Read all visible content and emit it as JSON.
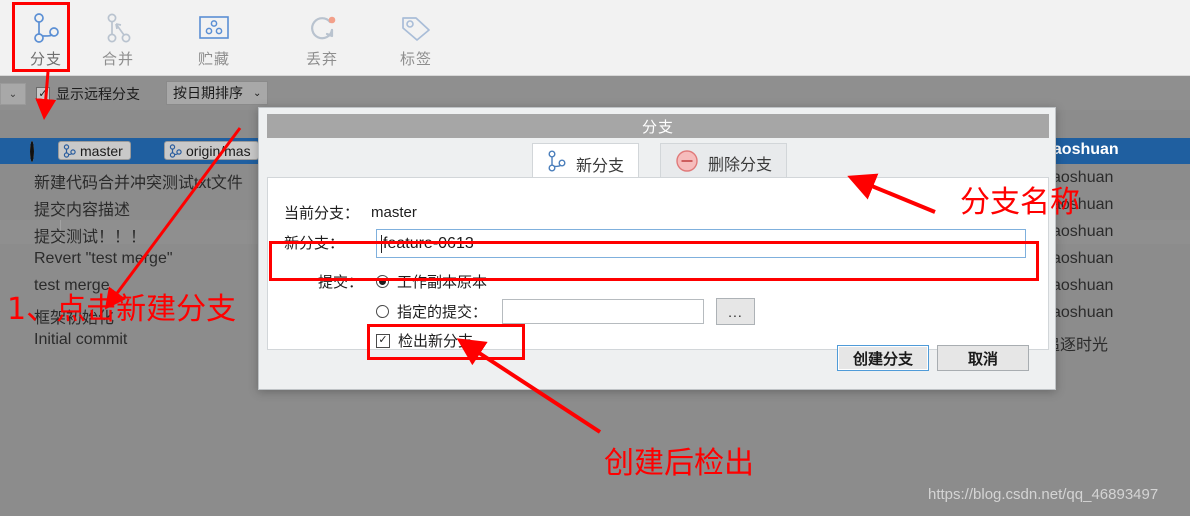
{
  "toolbar": {
    "items": [
      {
        "label": "分支",
        "icon": "branch-icon",
        "active": true
      },
      {
        "label": "合并",
        "icon": "merge-icon",
        "active": false
      },
      {
        "label": "贮藏",
        "icon": "stash-icon",
        "active": false
      },
      {
        "label": "丢弃",
        "icon": "discard-icon",
        "active": false
      },
      {
        "label": "标签",
        "icon": "tag-icon",
        "active": false
      }
    ]
  },
  "filter_bar": {
    "chevron": "⌄",
    "show_remote_label": "显示远程分支",
    "show_remote_checked": true,
    "sort_label": "按日期排序",
    "sort_chevron": "⌄"
  },
  "commit_list": {
    "rows": [
      {
        "message": "",
        "author": "yaoshuan",
        "selected": true,
        "refs": [
          {
            "label": "master",
            "icon": "branch-icon"
          },
          {
            "label": "origin/mas",
            "icon": "branch-icon"
          }
        ]
      },
      {
        "message": "新建代码合并冲突测试txt文件",
        "author": "yaoshuan",
        "selected": false,
        "refs": []
      },
      {
        "message": "提交内容描述",
        "author": "yaoshuan",
        "selected": false,
        "refs": []
      },
      {
        "message": "提交测试！！！",
        "author": "yaoshuan",
        "selected": false,
        "refs": []
      },
      {
        "message": "Revert \"test merge\"",
        "author": "yaoshuan",
        "selected": false,
        "refs": []
      },
      {
        "message": "test merge",
        "author": "yaoshuan",
        "selected": false,
        "refs": []
      },
      {
        "message": "框架初始化",
        "author": "yaoshuan",
        "selected": false,
        "refs": []
      },
      {
        "message": "Initial commit",
        "author": "追逐时光",
        "selected": false,
        "refs": []
      }
    ]
  },
  "dialog": {
    "title": "分支",
    "tabs": [
      {
        "label": "新分支",
        "icon": "branch-icon",
        "selected": true
      },
      {
        "label": "删除分支",
        "icon": "minus-circle-icon",
        "selected": false
      }
    ],
    "current_branch_label": "当前分支：",
    "current_branch_value": "master",
    "new_branch_label": "新分支：",
    "new_branch_value": "feature-0613",
    "commit_label": "提交：",
    "radio_working_copy": "工作副本原本",
    "radio_working_copy_selected": true,
    "radio_specified_commit": "指定的提交：",
    "radio_specified_selected": false,
    "specified_commit_value": "",
    "browse_button": "...",
    "checkout_label": "检出新分支",
    "checkout_checked": true,
    "create_button": "创建分支",
    "cancel_button": "取消"
  },
  "annotations": [
    {
      "id": "anno-click-new-branch",
      "text": "1、点击新建分支"
    },
    {
      "id": "anno-branch-name",
      "text": "分支名称"
    },
    {
      "id": "anno-checkout-after-create",
      "text": "创建后检出"
    }
  ],
  "watermark": "https://blog.csdn.net/qq_46893497",
  "colors": {
    "accent_blue": "#4a7ebb",
    "selection_blue": "#1f5fa0",
    "annotation_red": "#ff0000",
    "background_gray": "#8c8c8c"
  }
}
